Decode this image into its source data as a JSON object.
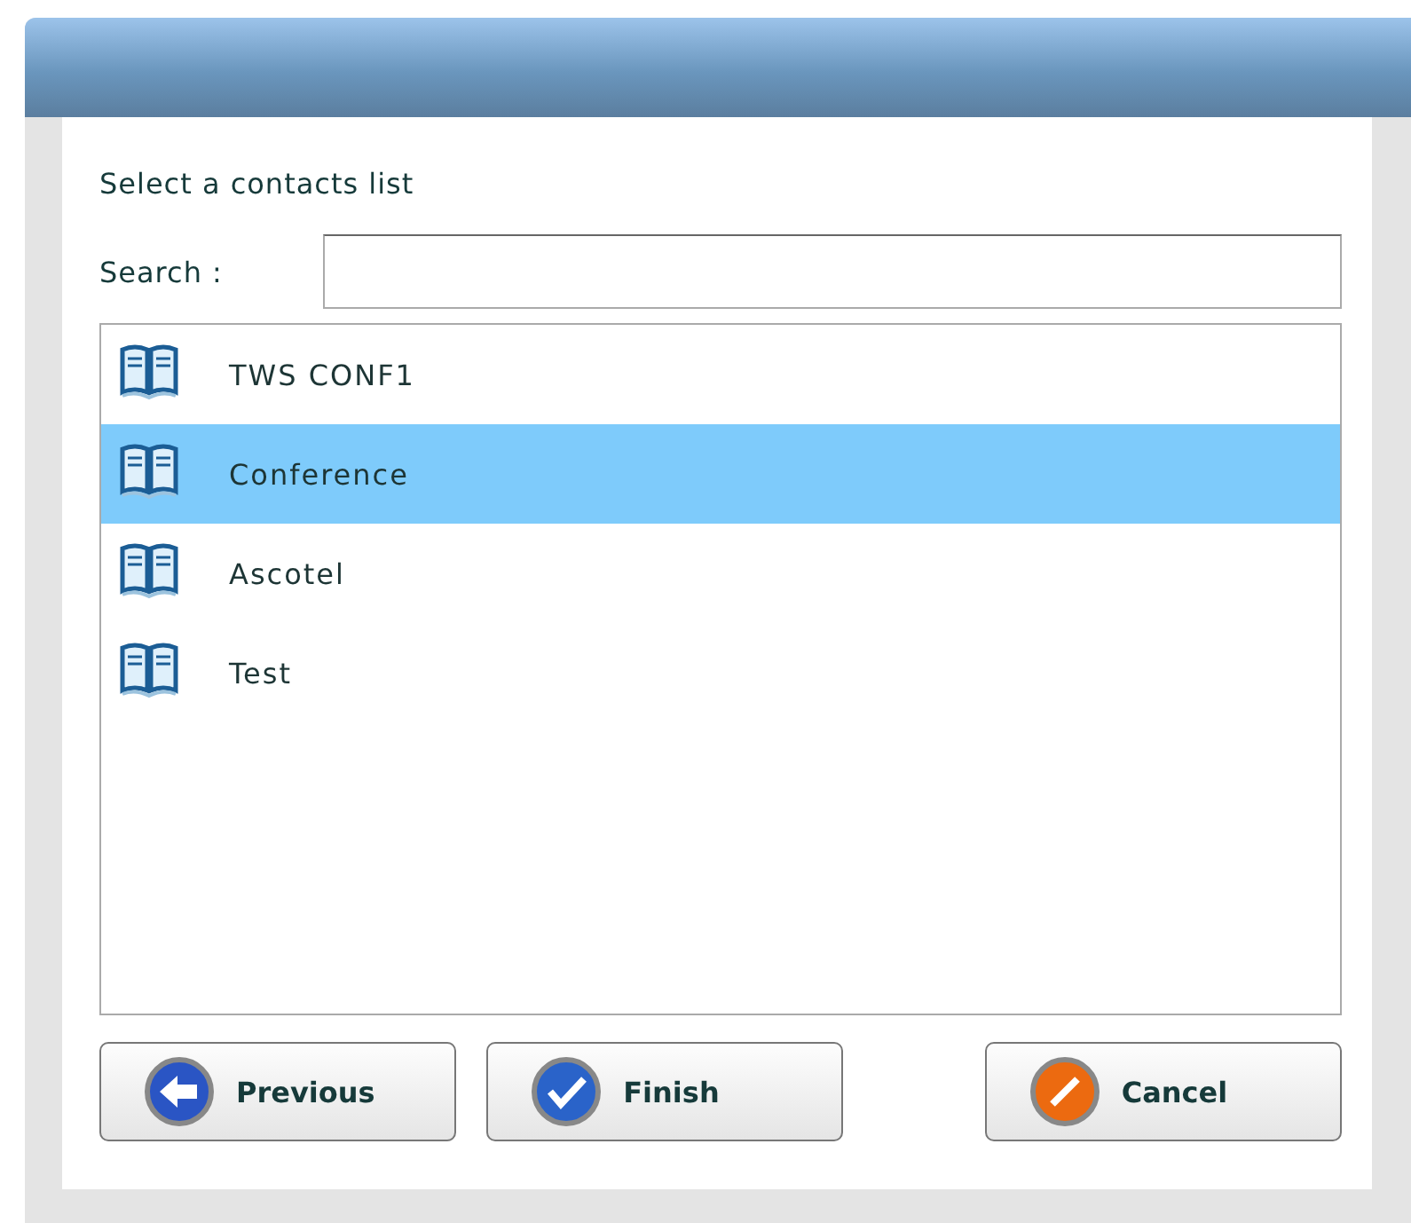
{
  "prompt": "Select a contacts list",
  "search": {
    "label": "Search :"
  },
  "lists": [
    {
      "name": "TWS CONF1",
      "selected": false
    },
    {
      "name": "Conference",
      "selected": true
    },
    {
      "name": "Ascotel",
      "selected": false
    },
    {
      "name": "Test",
      "selected": false
    }
  ],
  "buttons": [
    {
      "label": "Previous",
      "kind": "back"
    },
    {
      "label": "Finish",
      "kind": "finish"
    },
    {
      "label": "Cancel",
      "kind": "cancel"
    }
  ]
}
